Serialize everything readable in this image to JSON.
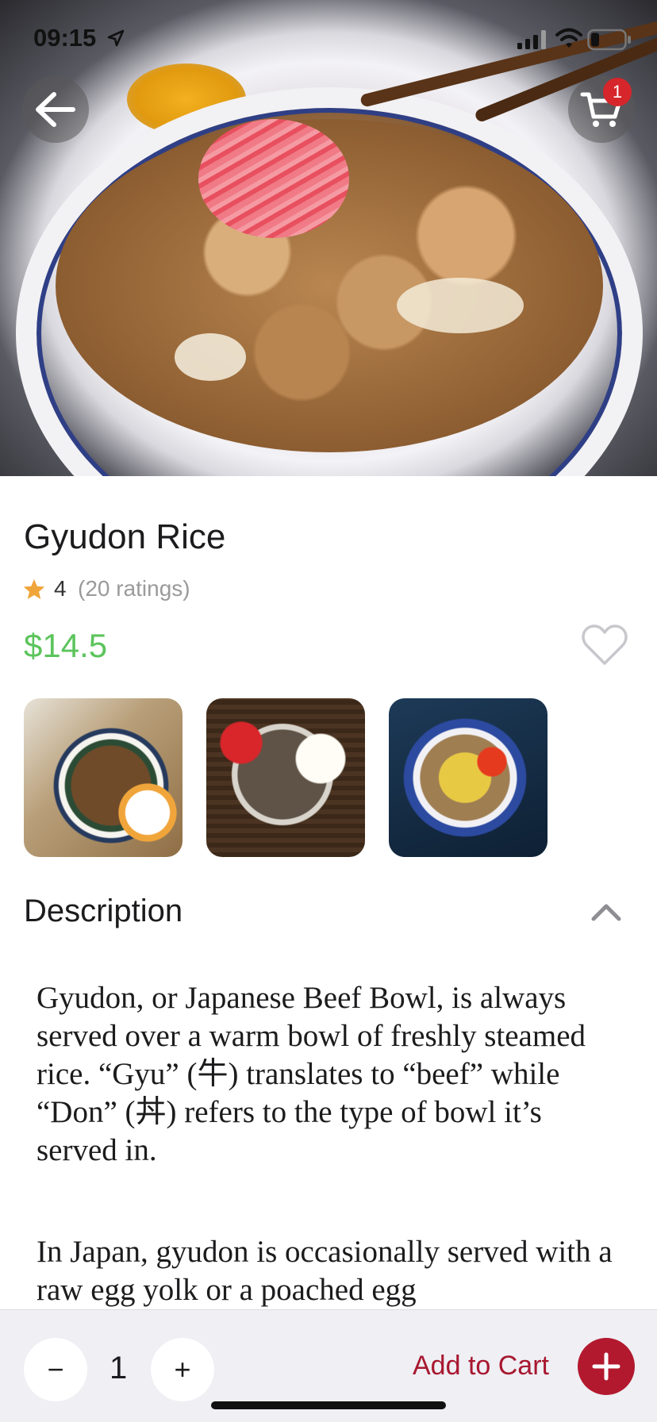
{
  "status_bar": {
    "time": "09:15",
    "icons": [
      "location-arrow-icon",
      "signal-icon",
      "wifi-icon",
      "battery-icon"
    ]
  },
  "header": {
    "back_icon": "arrow-left-icon",
    "cart_icon": "cart-icon",
    "cart_badge": "1"
  },
  "product": {
    "name": "Gyudon Rice",
    "rating": "4",
    "rating_count": "(20 ratings)",
    "price": "$14.5",
    "favorite_icon": "heart-outline-icon",
    "thumbnails": [
      "gyudon-egg-thumbnail",
      "gyudon-side-thumbnail",
      "gyudon-bowl-thumbnail"
    ]
  },
  "description": {
    "heading": "Description",
    "toggle_icon": "chevron-up-icon",
    "paragraphs": [
      "Gyudon, or Japanese Beef Bowl, is always served over a warm bowl of freshly steamed rice. “Gyu” (牛) translates to “beef” while “Don” (丼) refers to the type of bowl it’s served in.",
      "In Japan, gyudon is occasionally served with a raw egg yolk or a poached egg"
    ]
  },
  "bottom_bar": {
    "minus_label": "−",
    "quantity": "1",
    "plus_label": "+",
    "add_to_cart_label": "Add to Cart",
    "add_icon": "plus-icon"
  },
  "colors": {
    "price": "#5cc45c",
    "accent": "#b3192e",
    "badge": "#d6262b",
    "star": "#f0a53b"
  }
}
